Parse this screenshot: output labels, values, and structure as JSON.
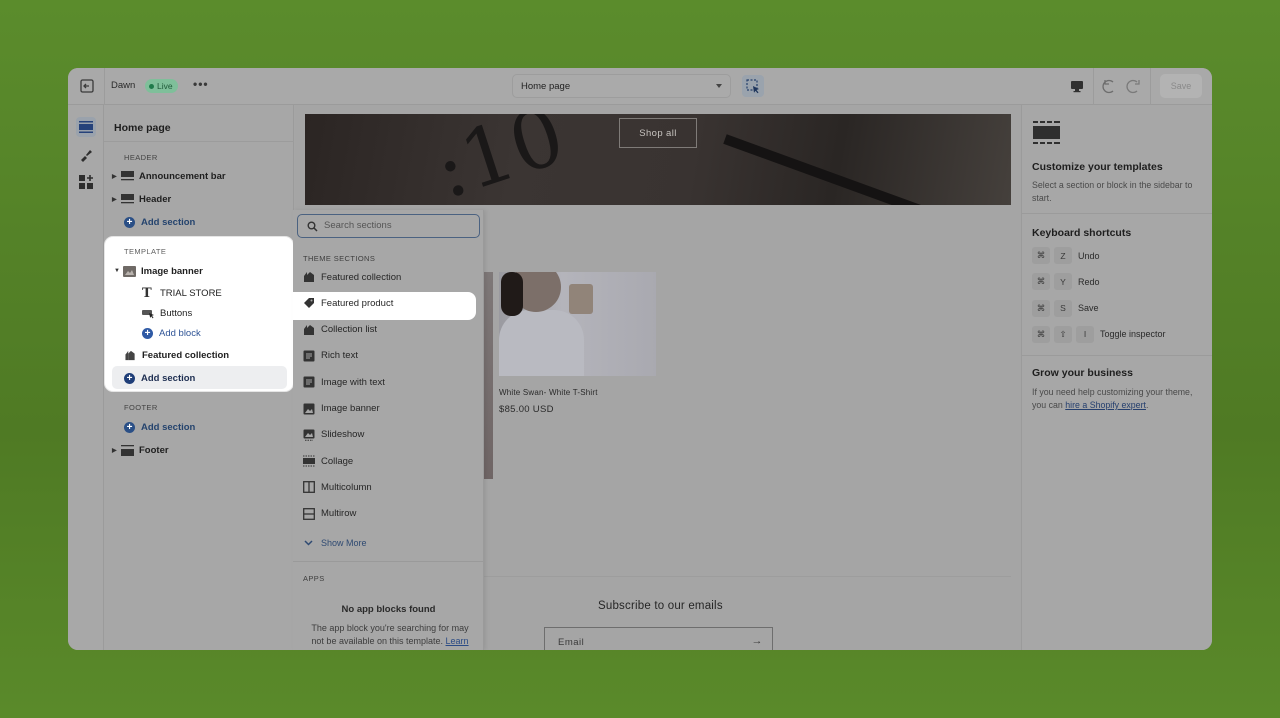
{
  "topbar": {
    "theme_name": "Dawn",
    "status_badge": "Live",
    "more_label": "•••",
    "page_selector": "Home page",
    "save_label": "Save"
  },
  "sidebar": {
    "title": "Home page",
    "header_group": {
      "label": "HEADER",
      "items": [
        {
          "label": "Announcement bar",
          "icon": "section-icon"
        },
        {
          "label": "Header",
          "icon": "section-icon"
        }
      ],
      "add_label": "Add section"
    },
    "template_group": {
      "label": "TEMPLATE",
      "image_banner": {
        "label": "Image banner",
        "blocks": [
          {
            "label": "TRIAL STORE",
            "icon": "text-icon"
          },
          {
            "label": "Buttons",
            "icon": "button-icon"
          }
        ],
        "add_block_label": "Add block"
      },
      "featured_collection": "Featured collection",
      "add_label": "Add section"
    },
    "footer_group": {
      "label": "FOOTER",
      "add_label": "Add section",
      "items": [
        {
          "label": "Footer",
          "icon": "footer-icon"
        }
      ]
    }
  },
  "picker": {
    "search_placeholder": "Search sections",
    "theme_sections_label": "THEME SECTIONS",
    "items": [
      {
        "label": "Featured collection",
        "icon": "collection-icon"
      },
      {
        "label": "Featured product",
        "icon": "tag-icon"
      },
      {
        "label": "Collection list",
        "icon": "collection-icon"
      },
      {
        "label": "Rich text",
        "icon": "text-block-icon"
      },
      {
        "label": "Image with text",
        "icon": "text-block-icon"
      },
      {
        "label": "Image banner",
        "icon": "image-icon"
      },
      {
        "label": "Slideshow",
        "icon": "slideshow-icon"
      },
      {
        "label": "Collage",
        "icon": "collage-icon"
      },
      {
        "label": "Multicolumn",
        "icon": "multicolumn-icon"
      },
      {
        "label": "Multirow",
        "icon": "multirow-icon"
      }
    ],
    "show_more_label": "Show More",
    "apps_label": "APPS",
    "no_apps_title": "No app blocks found",
    "no_apps_desc": "The app block you're searching for may not be available on this template.",
    "no_apps_link": "Learn"
  },
  "preview": {
    "banner_button": "Shop all",
    "product_title": "White Swan- White T-Shirt",
    "product_price": "$85.00 USD",
    "subscribe_title": "Subscribe to our emails",
    "email_placeholder": "Email",
    "email_arrow": "→"
  },
  "right_panel": {
    "customize_title": "Customize your templates",
    "customize_desc": "Select a section or block in the sidebar to start.",
    "shortcuts_title": "Keyboard shortcuts",
    "shortcuts": [
      {
        "keys": [
          "⌘",
          "Z"
        ],
        "label": "Undo"
      },
      {
        "keys": [
          "⌘",
          "Y"
        ],
        "label": "Redo"
      },
      {
        "keys": [
          "⌘",
          "S"
        ],
        "label": "Save"
      },
      {
        "keys": [
          "⌘",
          "⇧",
          "I"
        ],
        "label": "Toggle inspector"
      }
    ],
    "grow_title": "Grow your business",
    "grow_desc": "If you need help customizing your theme, you can",
    "grow_link": "hire a Shopify expert",
    "grow_tail": "."
  },
  "colors": {
    "background": "#55832a",
    "accent_blue": "#2a4f86",
    "live_badge": "#7fbf9a"
  }
}
